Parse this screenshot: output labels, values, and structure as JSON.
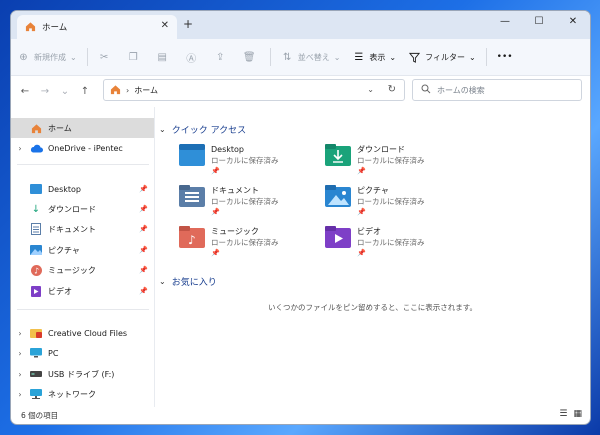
{
  "window": {
    "tab_title": "ホーム",
    "new_tab": "+",
    "close": "✕",
    "minimize": "—",
    "maximize": "☐",
    "close_window": "✕"
  },
  "toolbar": {
    "new_label": "新規作成",
    "sort_label": "並べ替え",
    "view_label": "表示",
    "filter_label": "フィルター",
    "more": "•••"
  },
  "address": {
    "path_root": "ホーム",
    "search_placeholder": "ホームの検索"
  },
  "sidebar": {
    "items": [
      {
        "label": "ホーム"
      },
      {
        "label": "OneDrive - iPentec"
      },
      {
        "label": "Desktop"
      },
      {
        "label": "ダウンロード"
      },
      {
        "label": "ドキュメント"
      },
      {
        "label": "ピクチャ"
      },
      {
        "label": "ミュージック"
      },
      {
        "label": "ビデオ"
      },
      {
        "label": "Creative Cloud Files"
      },
      {
        "label": "PC"
      },
      {
        "label": "USB ドライブ (F:)"
      },
      {
        "label": "ネットワーク"
      }
    ]
  },
  "main": {
    "quick_access_title": "クイック アクセス",
    "favorites_title": "お気に入り",
    "favorites_empty": "いくつかのファイルをピン留めすると、ここに表示されます。",
    "quick_access": [
      {
        "name": "Desktop",
        "sub": "ローカルに保存済み"
      },
      {
        "name": "ダウンロード",
        "sub": "ローカルに保存済み"
      },
      {
        "name": "ドキュメント",
        "sub": "ローカルに保存済み"
      },
      {
        "name": "ピクチャ",
        "sub": "ローカルに保存済み"
      },
      {
        "name": "ミュージック",
        "sub": "ローカルに保存済み"
      },
      {
        "name": "ビデオ",
        "sub": "ローカルに保存済み"
      }
    ]
  },
  "status": {
    "count": "6 個の項目"
  },
  "colors": {
    "accent": "#1a3f8f",
    "desktop_folder": "#2f8fd8",
    "download_folder": "#1aa37a",
    "docs_folder": "#5b7ea8",
    "pictures_folder": "#2a86d1",
    "music_folder": "#e06a5a",
    "video_folder": "#7e3fc7"
  }
}
